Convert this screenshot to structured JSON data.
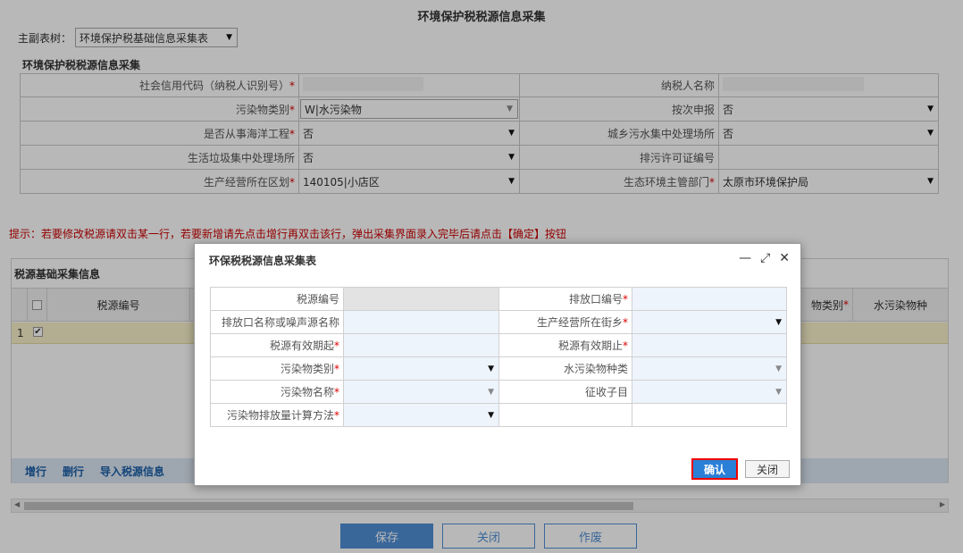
{
  "page": {
    "title": "环境保护税税源信息采集"
  },
  "tree": {
    "label": "主副表树：",
    "value": "环境保护税基础信息采集表"
  },
  "form": {
    "section_title": "环境保护税税源信息采集",
    "credit_code_label": "社会信用代码（纳税人识别号）",
    "taxpayer_name_label": "纳税人名称",
    "pollutant_type_label": "污染物类别",
    "pollutant_type_value": "W|水污染物",
    "per_time_label": "按次申报",
    "per_time_value": "否",
    "ocean_label": "是否从事海洋工程",
    "ocean_value": "否",
    "sewage_label": "城乡污水集中处理场所",
    "sewage_value": "否",
    "garbage_label": "生活垃圾集中处理场所",
    "garbage_value": "否",
    "permit_label": "排污许可证编号",
    "district_label": "生产经营所在区划",
    "district_value": "140105|小店区",
    "authority_label": "生态环境主管部门",
    "authority_value": "太原市环境保护局"
  },
  "tip": "提示：若要修改税源请双击某一行，若要新增请先点击增行再双击该行，弹出采集界面录入完毕后请点击【确定】按钮",
  "grid": {
    "title": "税源基础采集信息",
    "col_code": "税源编号",
    "col_pollutant_type": "物类别",
    "col_water_kind": "水污染物种",
    "row_index": "1",
    "add_row": "增行",
    "delete_row": "删行",
    "import": "导入税源信息"
  },
  "buttons": {
    "save": "保存",
    "close": "关闭",
    "void": "作废"
  },
  "dialog": {
    "title": "环保税税源信息采集表",
    "source_code": "税源编号",
    "outlet_code": "排放口编号",
    "outlet_name": "排放口名称或噪声源名称",
    "street": "生产经营所在街乡",
    "valid_from": "税源有效期起",
    "valid_to": "税源有效期止",
    "pollutant_type": "污染物类别",
    "water_kind": "水污染物种类",
    "pollutant_name": "污染物名称",
    "tax_item": "征收子目",
    "calc_method": "污染物排放量计算方法",
    "confirm": "确认",
    "close": "关闭"
  }
}
